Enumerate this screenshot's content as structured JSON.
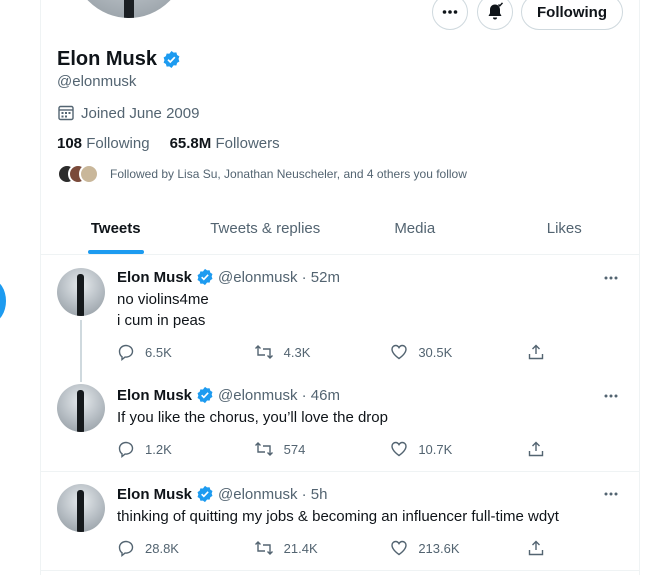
{
  "profile": {
    "name": "Elon Musk",
    "handle": "@elonmusk",
    "joined": "Joined June 2009",
    "following_count": "108",
    "following_label": "Following",
    "followers_count": "65.8M",
    "followers_label": "Followers",
    "followed_by": "Followed by Lisa Su, Jonathan Neuscheler, and 4 others you follow",
    "follow_button": "Following"
  },
  "tabs": [
    {
      "label": "Tweets",
      "active": true
    },
    {
      "label": "Tweets & replies",
      "active": false
    },
    {
      "label": "Media",
      "active": false
    },
    {
      "label": "Likes",
      "active": false
    }
  ],
  "tweets": [
    {
      "name": "Elon Musk",
      "meta": "@elonmusk · 52m",
      "lines": [
        "no violins4me",
        "i cum in peas"
      ],
      "replies": "6.5K",
      "retweets": "4.3K",
      "likes": "30.5K"
    },
    {
      "name": "Elon Musk",
      "meta": "@elonmusk · 46m",
      "lines": [
        "If you like the chorus, you’ll love the drop"
      ],
      "replies": "1.2K",
      "retweets": "574",
      "likes": "10.7K"
    },
    {
      "name": "Elon Musk",
      "meta": "@elonmusk · 5h",
      "lines": [
        "thinking of quitting my jobs & becoming an influencer full-time wdyt"
      ],
      "replies": "28.8K",
      "retweets": "21.4K",
      "likes": "213.6K"
    }
  ],
  "colors": {
    "accent": "#1d9bf0",
    "text_primary": "#0f1419",
    "text_secondary": "#536471",
    "border": "#eff3f4"
  }
}
